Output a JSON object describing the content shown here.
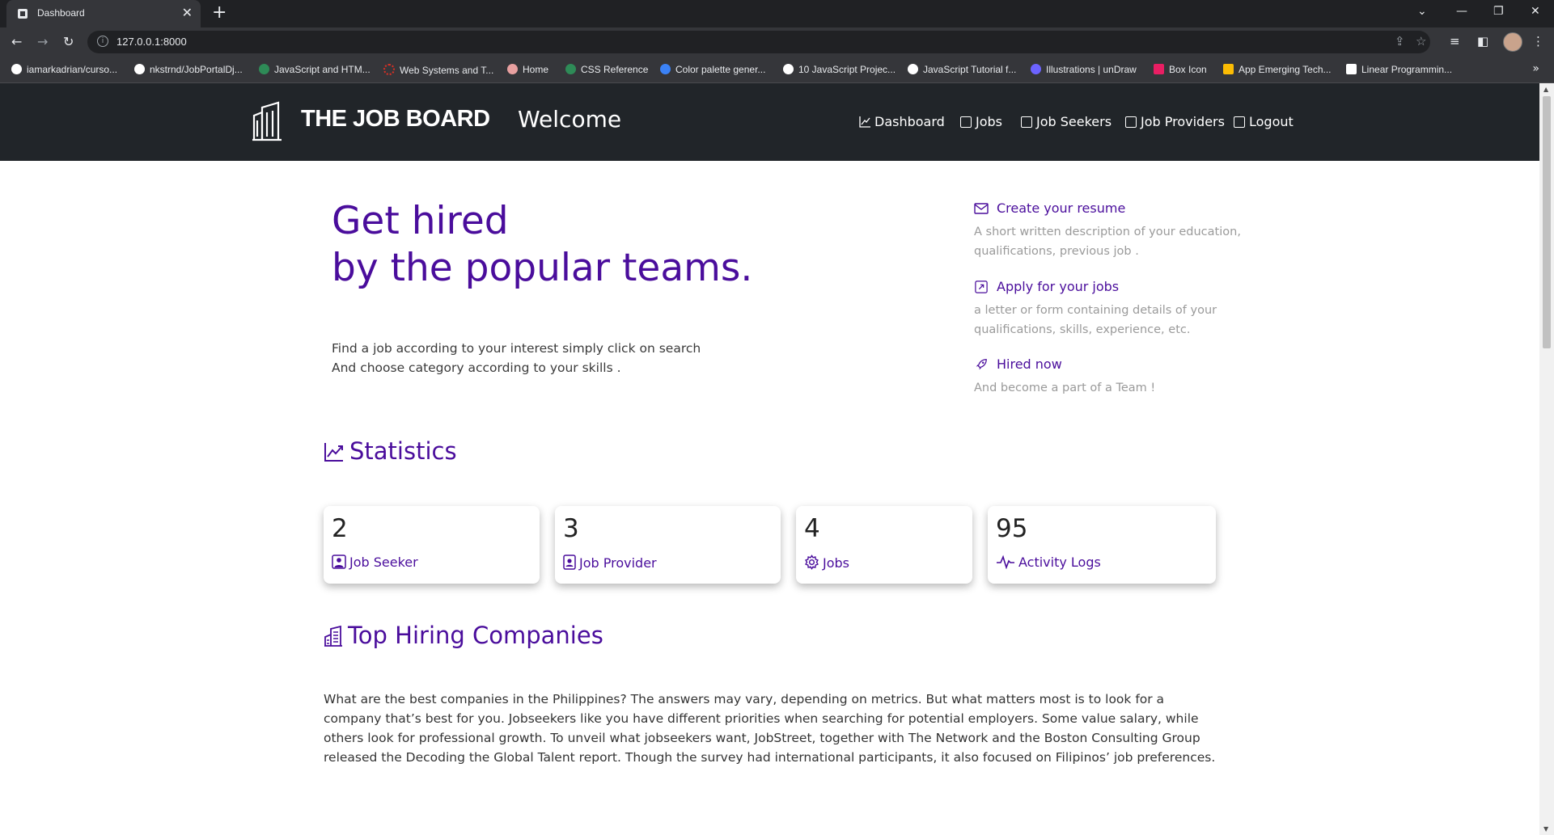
{
  "browser": {
    "tab_title": "Dashboard",
    "tab_close": "✕",
    "new_tab": "+",
    "url": "127.0.0.1:8000",
    "bookmarks": [
      {
        "label": "iamarkadrian/curso...",
        "icon_color": "#ffffff"
      },
      {
        "label": "nkstrnd/JobPortalDj...",
        "icon_color": "#ffffff"
      },
      {
        "label": "JavaScript and HTM...",
        "icon_color": "#2e8b57"
      },
      {
        "label": "Web Systems and T...",
        "icon_color": "#d93025"
      },
      {
        "label": "Home",
        "icon_color": "#e8a0a0"
      },
      {
        "label": "CSS Reference",
        "icon_color": "#2e8b57"
      },
      {
        "label": "Color palette gener...",
        "icon_color": "#3b82f6"
      },
      {
        "label": "10 JavaScript Projec...",
        "icon_color": "#ffffff"
      },
      {
        "label": "JavaScript Tutorial f...",
        "icon_color": "#ffffff"
      },
      {
        "label": "Illustrations | unDraw",
        "icon_color": "#6c63ff"
      },
      {
        "label": "Box Icon",
        "icon_color": "#e91e63"
      },
      {
        "label": "App Emerging Tech...",
        "icon_color": "#fbbc04"
      },
      {
        "label": "Linear Programmin...",
        "icon_color": "#ffffff"
      }
    ],
    "bookmarks_more": "»"
  },
  "navbar": {
    "brand": "THE JOB BOARD",
    "welcome": "Welcome",
    "items": [
      {
        "label": "Dashboard",
        "icon": "chart-line-icon"
      },
      {
        "label": "Jobs",
        "icon": "user-card-icon"
      },
      {
        "label": "Job Seekers",
        "icon": "id-card-icon"
      },
      {
        "label": "Job Providers",
        "icon": "building-icon"
      },
      {
        "label": "Logout",
        "icon": "logout-icon"
      }
    ]
  },
  "hero": {
    "title_line1": "Get hired",
    "title_line2": "by the popular teams.",
    "sub_line1": "Find a job according to your interest simply click on search",
    "sub_line2": "And choose category according to your skills ."
  },
  "features": [
    {
      "title": "Create your resume",
      "desc": "A short written description of your education, qualifications, previous job .",
      "icon": "envelope-icon"
    },
    {
      "title": "Apply for your jobs",
      "desc": "a letter or form containing details of your qualifications, skills, experience, etc.",
      "icon": "arrow-up-right-icon"
    },
    {
      "title": "Hired now",
      "desc": "And become a part of a Team !",
      "icon": "rocket-icon"
    }
  ],
  "statistics": {
    "title": "Statistics",
    "cards": [
      {
        "value": "2",
        "label": "Job Seeker",
        "icon": "user-square-icon"
      },
      {
        "value": "3",
        "label": "Job Provider",
        "icon": "user-badge-icon"
      },
      {
        "value": "4",
        "label": "Jobs",
        "icon": "gear-icon"
      },
      {
        "value": "95",
        "label": "Activity Logs",
        "icon": "pulse-icon"
      }
    ]
  },
  "companies": {
    "title": "Top Hiring Companies",
    "text": "What are the best companies in the Philippines? The answers may vary, depending on metrics. But what matters most is to look for a company that’s best for you. Jobseekers like you have different priorities when searching for potential employers. Some value salary, while others look for professional growth. To unveil what jobseekers want, JobStreet, together with The Network and the Boston Consulting Group released the Decoding the Global Talent report. Though the survey had international participants, it also focused on Filipinos’ job preferences."
  },
  "colors": {
    "accent": "#4a0d9c",
    "navbar_bg": "#212529"
  }
}
